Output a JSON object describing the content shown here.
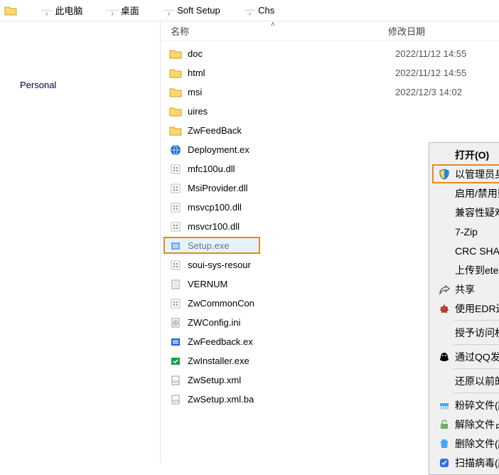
{
  "breadcrumb": {
    "items": [
      "此电脑",
      "桌面",
      "Soft Setup",
      "Chs"
    ]
  },
  "nav": {
    "personal": "Personal"
  },
  "columns": {
    "name": "名称",
    "date": "修改日期"
  },
  "files": [
    {
      "icon": "folder",
      "name": "doc",
      "date": "2022/11/12 14:55"
    },
    {
      "icon": "folder",
      "name": "html",
      "date": "2022/11/12 14:55"
    },
    {
      "icon": "folder",
      "name": "msi",
      "date": "2022/12/3 14:02"
    },
    {
      "icon": "folder",
      "name": "uires",
      "date": ""
    },
    {
      "icon": "folder",
      "name": "ZwFeedBack",
      "date": ""
    },
    {
      "icon": "globe",
      "name": "Deployment.ex",
      "date": ""
    },
    {
      "icon": "dll",
      "name": "mfc100u.dll",
      "date": ""
    },
    {
      "icon": "dll",
      "name": "MsiProvider.dll",
      "date": ""
    },
    {
      "icon": "dll",
      "name": "msvcp100.dll",
      "date": ""
    },
    {
      "icon": "dll",
      "name": "msvcr100.dll",
      "date": ""
    },
    {
      "icon": "exe",
      "name": "Setup.exe",
      "date": "",
      "selected": true
    },
    {
      "icon": "dll",
      "name": "soui-sys-resour",
      "date": ""
    },
    {
      "icon": "file",
      "name": "VERNUM",
      "date": ""
    },
    {
      "icon": "dll",
      "name": "ZwCommonCon",
      "date": ""
    },
    {
      "icon": "ini",
      "name": "ZWConfig.ini",
      "date": ""
    },
    {
      "icon": "exe",
      "name": "ZwFeedback.ex",
      "date": ""
    },
    {
      "icon": "exe2",
      "name": "ZwInstaller.exe",
      "date": ""
    },
    {
      "icon": "xml",
      "name": "ZwSetup.xml",
      "date": ""
    },
    {
      "icon": "xml",
      "name": "ZwSetup.xml.ba",
      "date": ""
    }
  ],
  "ctxmenu": {
    "open": "打开(O)",
    "run_admin": "以管理员身份运行(A)",
    "toggle_sig": "启用/禁用数字签名图标",
    "compat": "兼容性疑难解答(Y)",
    "sevenzip": "7-Zip",
    "crcsha": "CRC SHA",
    "upload_eteams": "上传到eteams",
    "share": "共享",
    "edr": "使用EDR进行扫描",
    "grant_access": "授予访问权限(G)",
    "qq_send": "通过QQ发送到",
    "restore": "还原以前的版本(V)",
    "shred": "粉碎文件(腾讯电脑管家)",
    "release": "解除文件占用(腾讯电脑管家)",
    "delete": "删除文件(腾讯电脑管家)",
    "virus": "扫描病毒(腾讯电脑管家)"
  }
}
